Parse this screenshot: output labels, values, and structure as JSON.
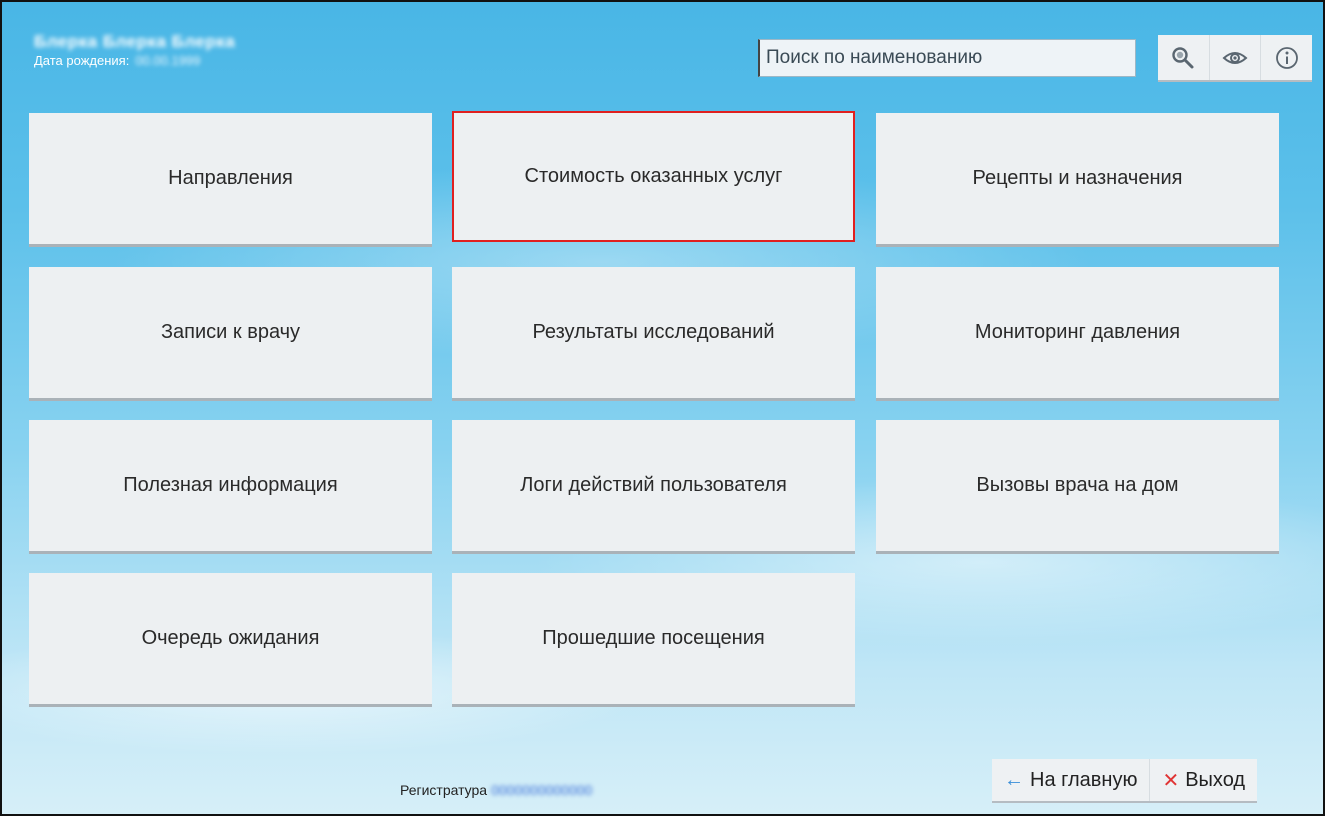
{
  "patient": {
    "name": "Блерка Блерка Блерка",
    "dob_label": "Дата рождения:",
    "dob_value": "00.00.1999"
  },
  "search": {
    "placeholder": "Поиск по наименованию"
  },
  "toolbar": {
    "icons": [
      "search-icon",
      "eye-icon",
      "info-icon"
    ]
  },
  "tiles": [
    {
      "label": "Направления",
      "selected": false
    },
    {
      "label": "Стоимость оказанных услуг",
      "selected": true
    },
    {
      "label": "Рецепты и назначения",
      "selected": false
    },
    {
      "label": "Записи к врачу",
      "selected": false
    },
    {
      "label": "Результаты исследований",
      "selected": false
    },
    {
      "label": "Мониторинг давления",
      "selected": false
    },
    {
      "label": "Полезная информация",
      "selected": false
    },
    {
      "label": "Логи действий пользователя",
      "selected": false
    },
    {
      "label": "Вызовы врача на дом",
      "selected": false
    },
    {
      "label": "Очередь ожидания",
      "selected": false
    },
    {
      "label": "Прошедшие посещения",
      "selected": false
    }
  ],
  "footer": {
    "registry_label": "Регистратура",
    "registry_value": "0000000000000",
    "home_label": "На главную",
    "exit_label": "Выход"
  },
  "colors": {
    "selected_border": "#e02020",
    "tile_bg": "#edf0f2",
    "accent_arrow": "#3a8fd8",
    "exit_cross": "#e03434"
  }
}
